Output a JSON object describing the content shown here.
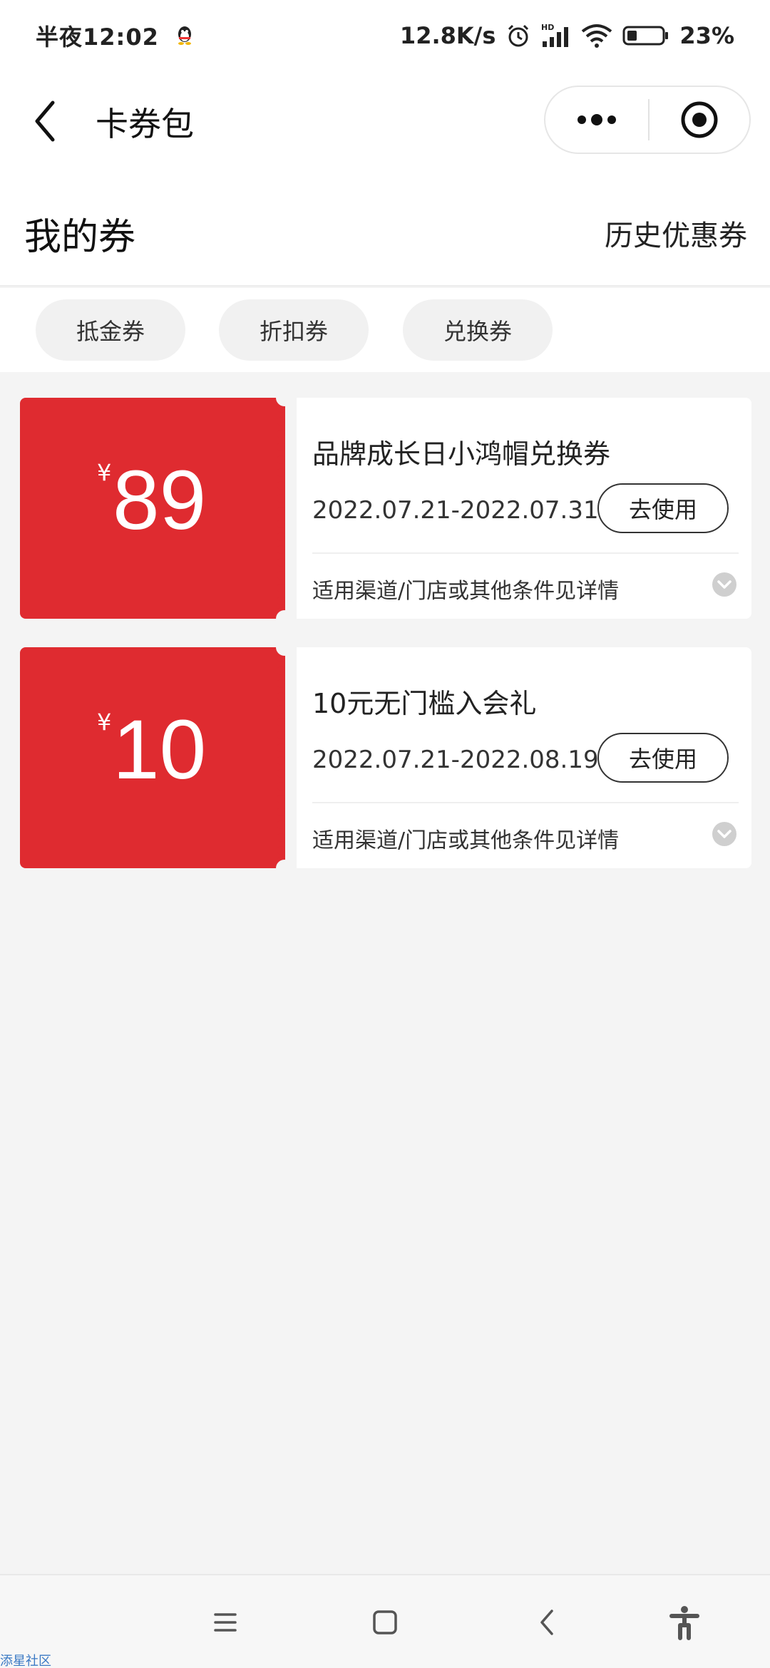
{
  "status_bar": {
    "time": "半夜12:02",
    "network_speed": "12.8K/s",
    "network_badge": "HD",
    "battery": "23%",
    "icons": [
      "qq-icon",
      "alarm-icon",
      "signal-icon",
      "wifi-icon",
      "battery-icon"
    ]
  },
  "nav": {
    "title": "卡券包",
    "icons": [
      "back-icon",
      "more-icon",
      "close-target-icon"
    ]
  },
  "header": {
    "title": "我的券",
    "history_link": "历史优惠券"
  },
  "filters": [
    {
      "label": "抵金券"
    },
    {
      "label": "折扣券"
    },
    {
      "label": "兑换券"
    }
  ],
  "coupons": [
    {
      "currency": "¥",
      "amount": "89",
      "name": "品牌成长日小鸿帽兑换券",
      "date_range": "2022.07.21-2022.07.31",
      "action": "去使用",
      "conditions": "适用渠道/门店或其他条件见详情"
    },
    {
      "currency": "¥",
      "amount": "10",
      "name": "10元无门槛入会礼",
      "date_range": "2022.07.21-2022.08.19",
      "action": "去使用",
      "conditions": "适用渠道/门店或其他条件见详情"
    }
  ],
  "system_nav": {
    "icons": [
      "menu-icon",
      "home-icon",
      "back-nav-icon",
      "accessibility-icon"
    ]
  },
  "watermark": "添星社区",
  "colors": {
    "coupon_red": "#df2b30",
    "background": "#f4f4f4",
    "card": "#ffffff"
  }
}
